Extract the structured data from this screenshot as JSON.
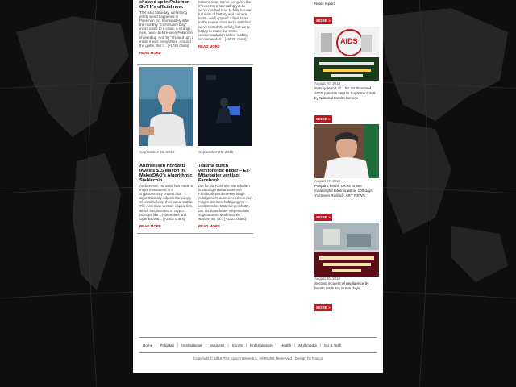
{
  "left_stories_top": [
    {
      "title": "showed up in Pokemon Go? It's official now.",
      "body": "This past Saturday, something pretty weird happened in Pokémon Go. Immediately after the monthly \"Community Day\" event came to a close, a strange, new, never-before-seen Pokemon showed up. And by \"showed up\", I mean it was everywhere. Around the globe, this t... [+1785 chars]",
      "read_more": "READ MORE"
    },
    {
      "title": "",
      "body": "Editor's note: We've not given the iPhone XS a star rating yet as we've not had time to fully run our full suite of battery and camera tests - we'll append a final score to the review once we're satisfied we've tested them fully, but we're happy to make our entire recommendation before making recommendati... [+5526 chars]",
      "read_more": "READ MORE"
    }
  ],
  "left_stories_bottom": [
    {
      "date": "September 25, 2018",
      "title": "Andreessen Horowitz Invests $15 Million in MakerDAO's Algorithmic Stablecoin",
      "body": "Andreessen Horowitz has made a major investment in a cryptocurrency project that algorithmically adjusts the supply of coins to keep their value stable. The American venture capital firm, which has invested in crypto startups like CryptoKitties and OpenBazaar... [+2902 chars]",
      "read_more": "READ MORE",
      "image_icon": "man-portrait-photo"
    },
    {
      "date": "September 26, 2018",
      "title": "Trauma durch verstörende Bilder – Ex-Mitarbeiter verklagt Facebook",
      "body": "Die für die Kontrolle von Inhalten zuständigen Mitarbeiter von Facebook werden einer klage zufolge nicht ausreichend von den Folgen der Beschäftigung mit verstörenden Material geschützt. Die als Zeitarbeiter eingestellten sogenannten Moderatoren würden mit Ta... [+1223 chars]",
      "read_more": "READ MORE",
      "image_icon": "dark-office-photo"
    }
  ],
  "sidebar": {
    "top_text": "News report",
    "more_label": "MORE »",
    "items": [
      {
        "image_icon": "aids-awareness-photo",
        "image_label": "AIDS",
        "date": "August 20, 2018",
        "text": "Survey report of 1 lac 30 thousand AIDS patients sent to Supreme Court by National Health Service"
      },
      {
        "image_icon": "official-portrait-photo",
        "date": "August 27, 2018",
        "text": "Punjab's health sector to see meaningful reforms within 100 days: Yasmeen Rashid - ARY NEWS"
      },
      {
        "image_icon": "hospital-news-photo",
        "date": "August 26, 2018",
        "text": "Second incident of negligence by health institutes in two days"
      }
    ]
  },
  "footer": {
    "nav": [
      "Home",
      "Pakistan",
      "International",
      "Business",
      "Sports",
      "Entertainment",
      "Health",
      "Multimedia",
      "Sci & Tech"
    ],
    "copyright": "Copyright © 2018 The Epoch News Inc. All Rights Reserved | Design by Rasco"
  },
  "colors": {
    "background": "#0d0d0d",
    "accent_red": "#c8141c",
    "page": "#ffffff"
  }
}
